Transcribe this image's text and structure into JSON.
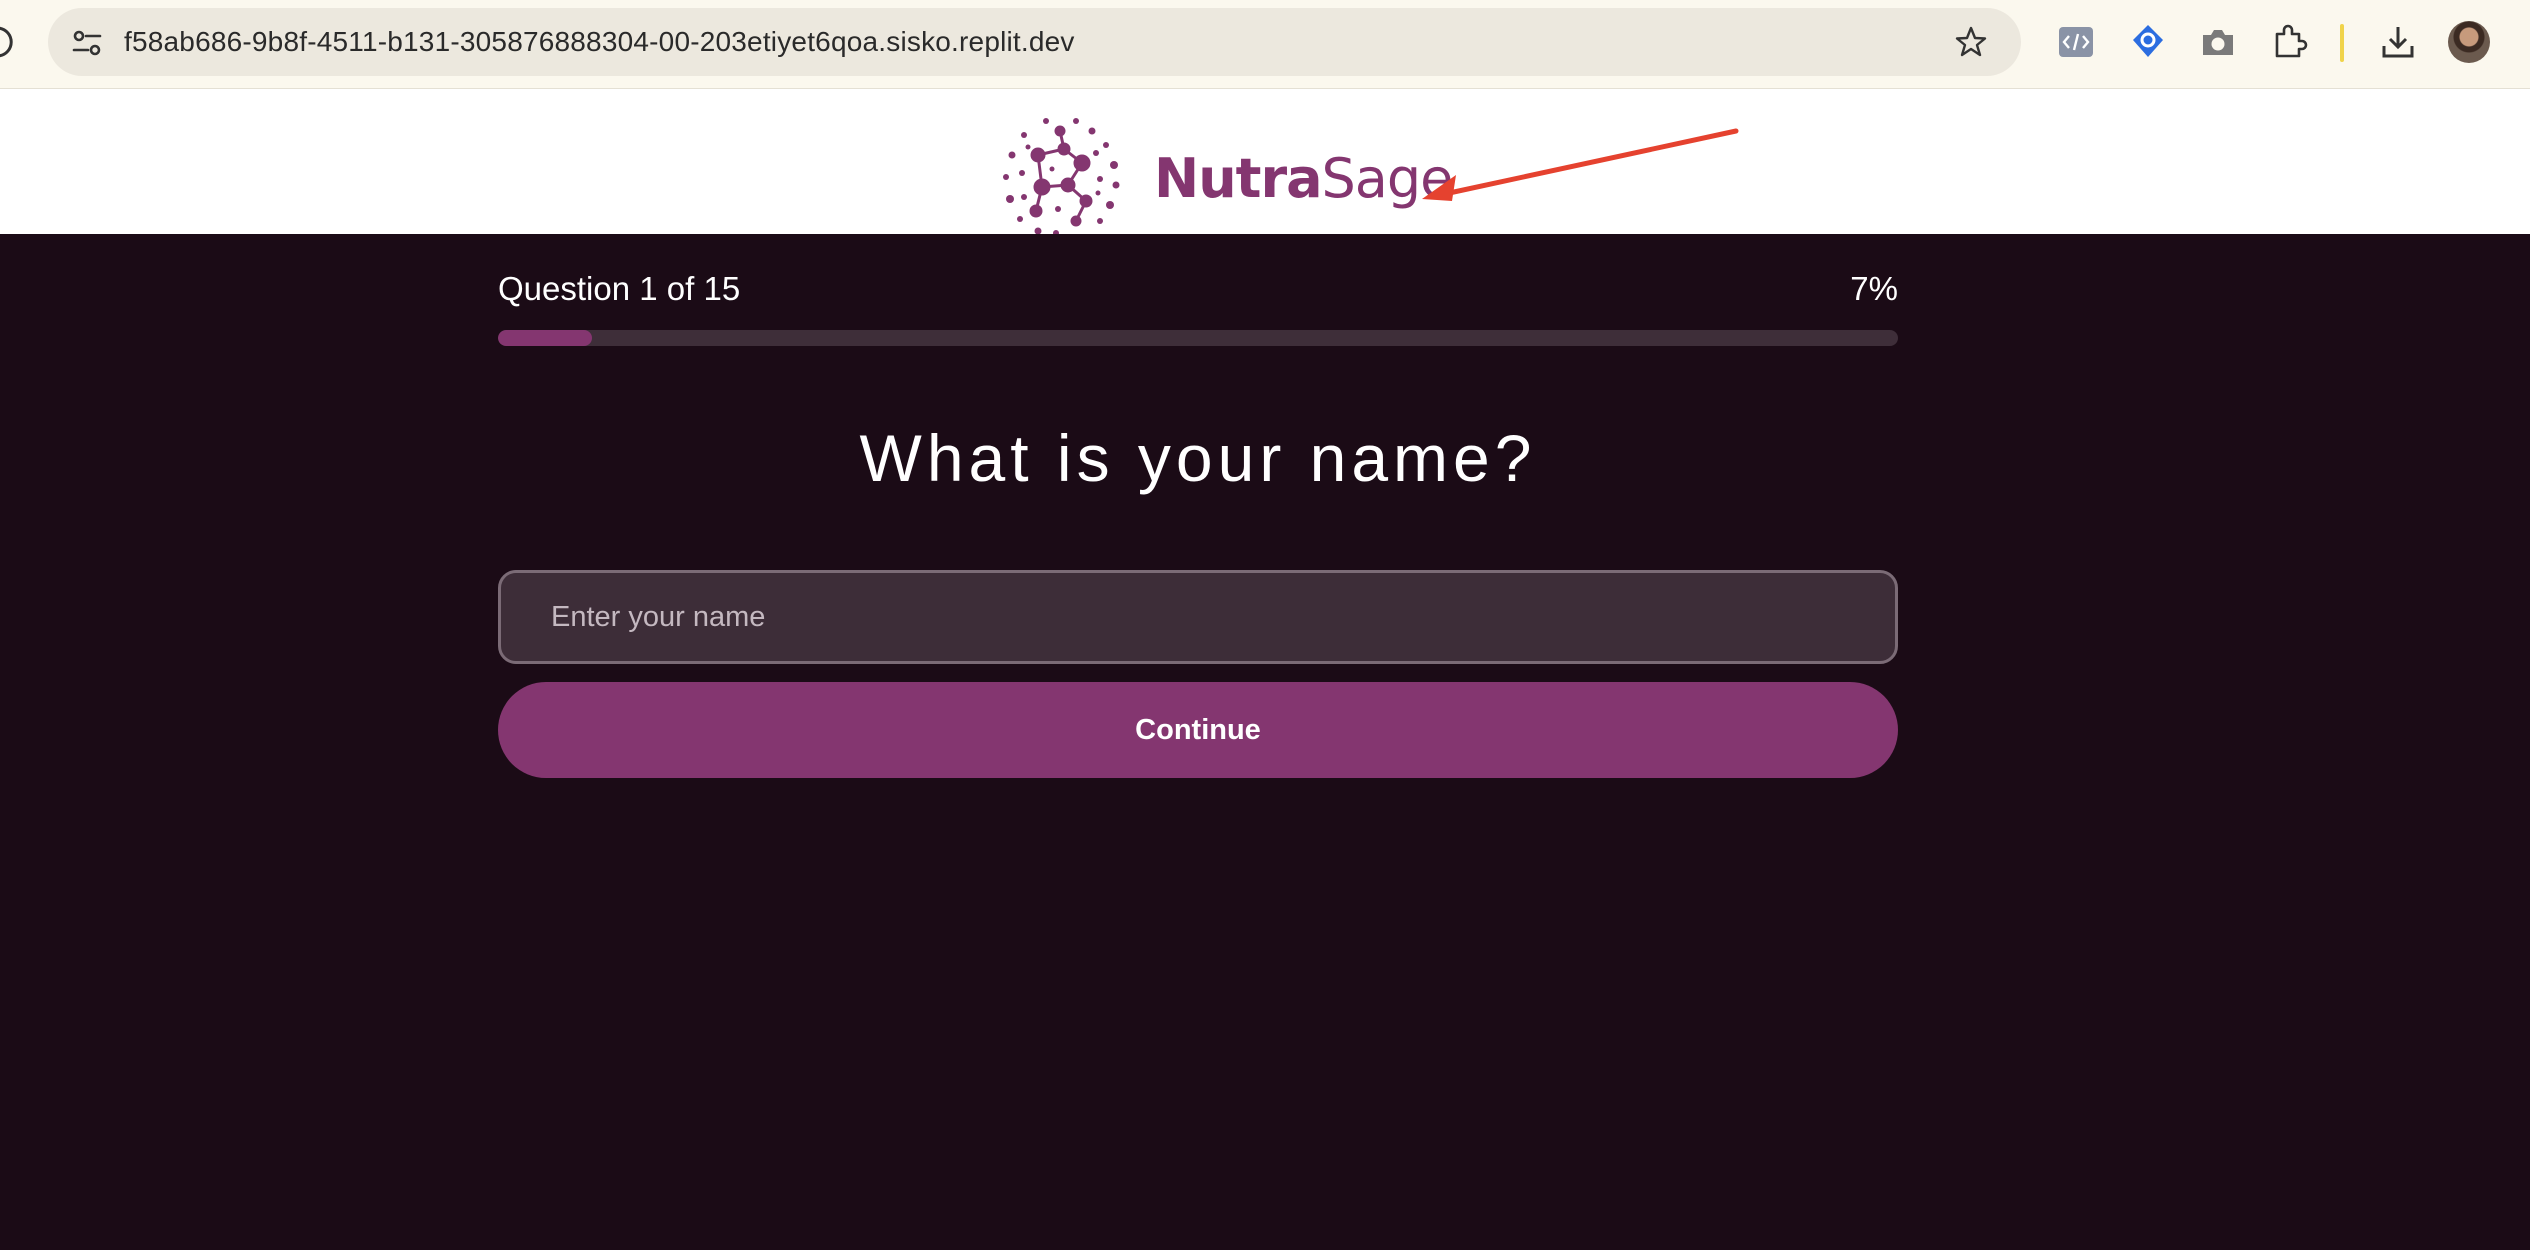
{
  "browser": {
    "url": "f58ab686-9b8f-4511-b131-305876888304-00-203etiyet6qoa.sisko.replit.dev",
    "icons": [
      "reload-icon",
      "site-info-icon",
      "bookmark-star-icon",
      "code-extension-icon",
      "tag-extension-icon",
      "camera-extension-icon",
      "puzzle-extensions-icon",
      "download-icon",
      "profile-avatar"
    ]
  },
  "brand": {
    "name_bold": "Nutra",
    "name_regular": "Sage",
    "color": "#843670"
  },
  "quiz": {
    "counter": "Question 1 of 15",
    "percent_label": "7%",
    "progress_fraction": 0.067,
    "question": "What is your name?",
    "input_placeholder": "Enter your name",
    "input_value": "",
    "continue_label": "Continue"
  },
  "colors": {
    "background": "#1b0b16",
    "accent": "#843670",
    "annotation": "#e5422f"
  }
}
